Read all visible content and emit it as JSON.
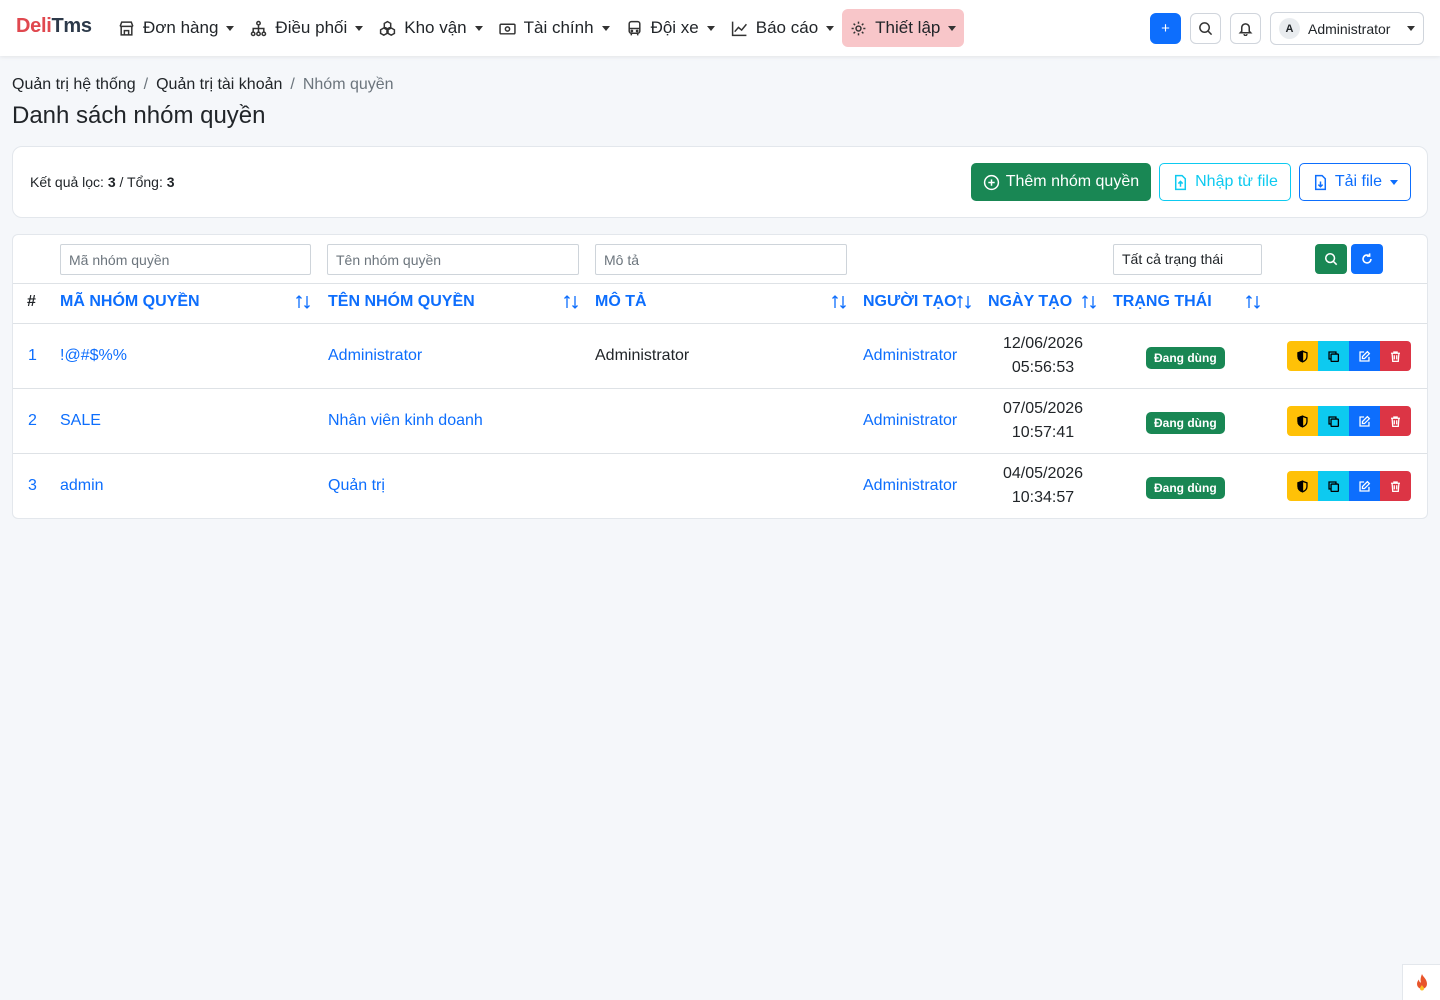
{
  "app": {
    "brand_part1": "Deli",
    "brand_part2": "Tms"
  },
  "nav": {
    "menus": [
      {
        "label": "Đơn hàng",
        "icon": "store-icon"
      },
      {
        "label": "Điều phối",
        "icon": "hierarchy-icon"
      },
      {
        "label": "Kho vận",
        "icon": "boxes-icon"
      },
      {
        "label": "Tài chính",
        "icon": "cash-icon"
      },
      {
        "label": "Đội xe",
        "icon": "bus-icon"
      },
      {
        "label": "Báo cáo",
        "icon": "chart-icon"
      },
      {
        "label": "Thiết lập",
        "icon": "gear-icon",
        "active": true
      }
    ],
    "add_label": "+",
    "user": {
      "initial": "A",
      "name": "Administrator"
    }
  },
  "breadcrumb": {
    "item1": "Quản trị hệ thống",
    "item2": "Quản trị tài khoản",
    "current": "Nhóm quyền",
    "sep": "/"
  },
  "page_title": "Danh sách nhóm quyền",
  "summary": {
    "filtered_label": "Kết quả lọc:",
    "filtered": "3",
    "total_label": "/ Tổng:",
    "total": "3"
  },
  "actions": {
    "add": "Thêm nhóm quyền",
    "import": "Nhập từ file",
    "download": "Tải file"
  },
  "filters": {
    "code_placeholder": "Mã nhóm quyền",
    "name_placeholder": "Tên nhóm quyền",
    "desc_placeholder": "Mô tả",
    "status_value": "Tất cả trạng thái"
  },
  "columns": {
    "index": "#",
    "code": "MÃ NHÓM QUYỀN",
    "name": "TÊN NHÓM QUYỀN",
    "desc": "MÔ TẢ",
    "creator": "NGƯỜI TẠO",
    "created": "NGÀY TẠO",
    "status": "TRẠNG THÁI"
  },
  "rows": [
    {
      "index": "1",
      "code": "!@#$%%",
      "name": "Administrator",
      "desc": "Administrator",
      "creator": "Administrator",
      "date": "12/06/2026",
      "time": "05:56:53",
      "status": "Đang dùng"
    },
    {
      "index": "2",
      "code": "SALE",
      "name": "Nhân viên kinh doanh",
      "desc": "",
      "creator": "Administrator",
      "date": "07/05/2026",
      "time": "10:57:41",
      "status": "Đang dùng"
    },
    {
      "index": "3",
      "code": "admin",
      "name": "Quản trị",
      "desc": "",
      "creator": "Administrator",
      "date": "04/05/2026",
      "time": "10:34:57",
      "status": "Đang dùng"
    }
  ],
  "colors": {
    "primary": "#0d6efd",
    "success": "#198754",
    "warning": "#ffc107",
    "info": "#0dcaf0",
    "danger": "#dc3545",
    "brand_red": "#e0484f",
    "active_menu_bg": "#f8c6c9"
  }
}
